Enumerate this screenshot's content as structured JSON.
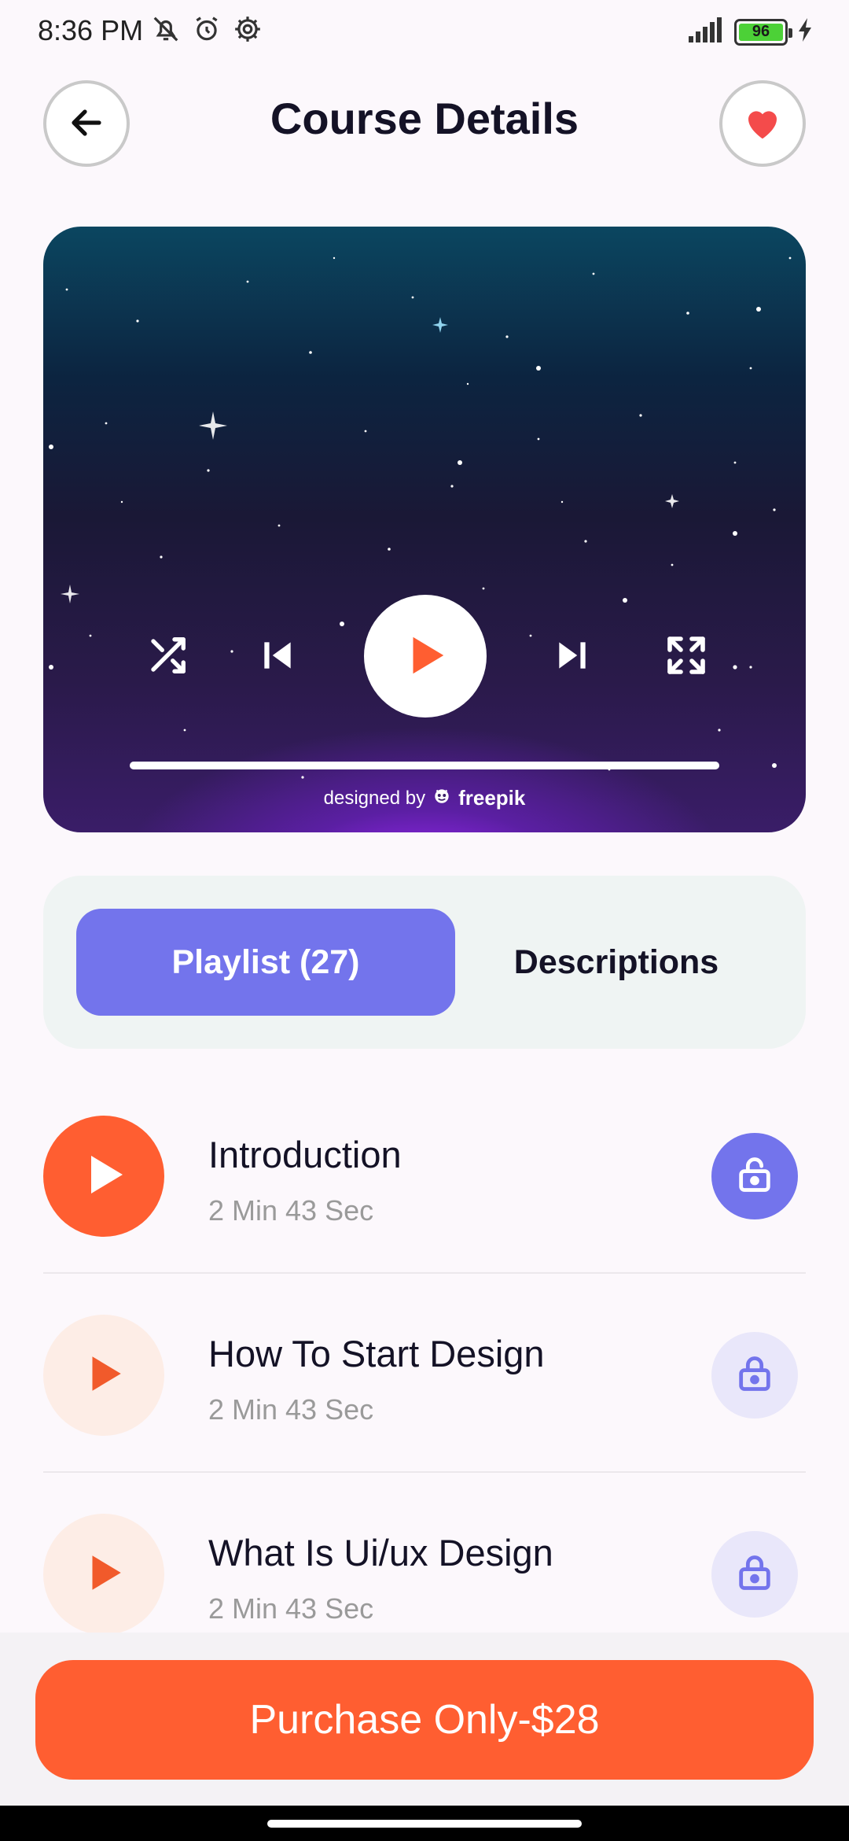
{
  "status_bar": {
    "time": "8:36 PM",
    "battery": "96",
    "icons": [
      "mute-bell-icon",
      "alarm-icon",
      "settings-icon",
      "signal-icon",
      "charging-icon"
    ]
  },
  "header": {
    "title": "Course Details",
    "back_icon": "arrow-left-icon",
    "favorite_icon": "heart-icon"
  },
  "player": {
    "credit_prefix": "designed by",
    "credit_brand": "freepik",
    "progress": 1.0,
    "controls": [
      "shuffle-icon",
      "skip-previous-icon",
      "play-icon",
      "skip-next-icon",
      "fullscreen-icon"
    ]
  },
  "tabs": [
    {
      "label": "Playlist (27)",
      "active": true
    },
    {
      "label": "Descriptions",
      "active": false
    }
  ],
  "lessons": [
    {
      "title": "Introduction",
      "duration": "2 Min 43 Sec",
      "active": true
    },
    {
      "title": "How To Start Design",
      "duration": "2 Min 43 Sec",
      "active": false
    },
    {
      "title": "What Is Ui/ux Design",
      "duration": "2 Min 43 Sec",
      "active": false
    }
  ],
  "purchase": {
    "label": "Purchase Only-$28"
  },
  "colors": {
    "accent_orange": "#FF5E31",
    "accent_purple": "#7374EC",
    "background": "#FCF8FC"
  }
}
